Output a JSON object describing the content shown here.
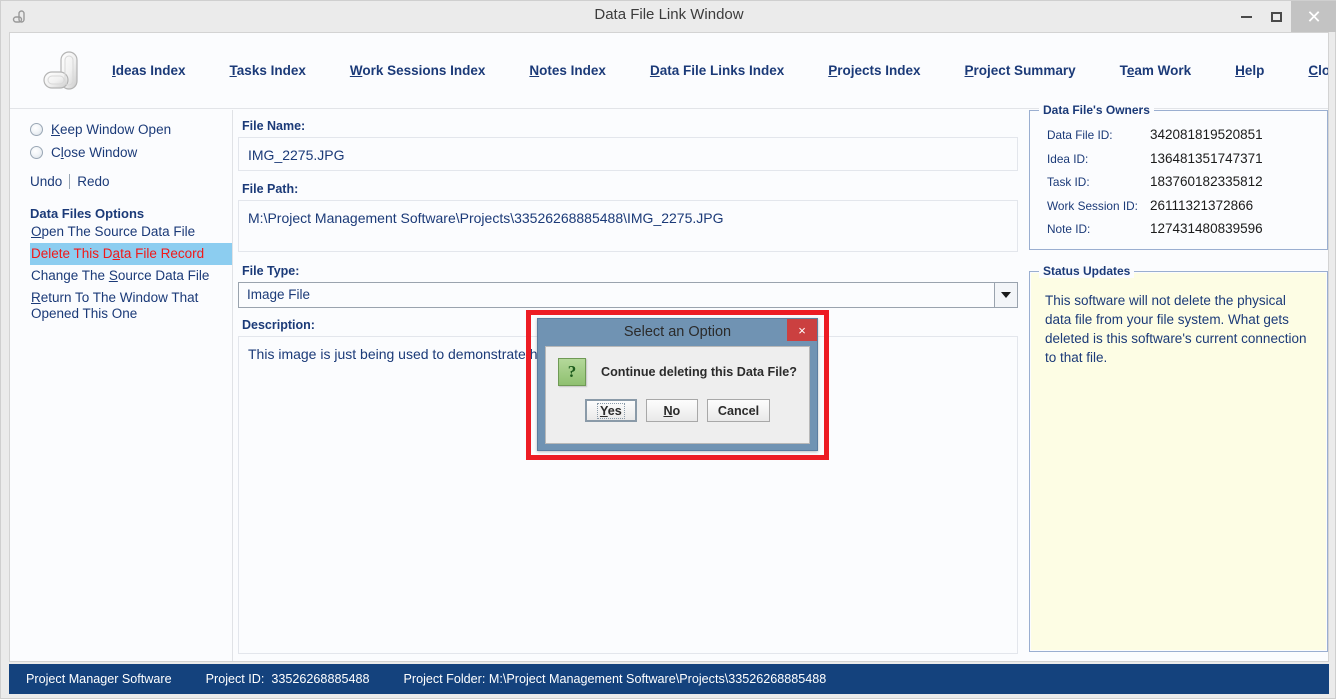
{
  "window": {
    "title": "Data File Link Window",
    "icon": "app-logo-icon",
    "controls": {
      "minimize": "–",
      "maximize": "□",
      "close": "✕"
    }
  },
  "nav": {
    "items": [
      {
        "label": "Ideas Index",
        "mnemonic": "I",
        "rest": "deas Index"
      },
      {
        "label": "Tasks Index",
        "mnemonic": "T",
        "rest": "asks Index"
      },
      {
        "label": "Work Sessions Index",
        "mnemonic": "W",
        "rest": "ork Sessions Index"
      },
      {
        "label": "Notes Index",
        "mnemonic": "N",
        "rest": "otes Index"
      },
      {
        "label": "Data File Links Index",
        "mnemonic": "D",
        "rest": "ata File Links Index"
      },
      {
        "label": "Projects Index",
        "mnemonic": "P",
        "rest": "rojects Index"
      },
      {
        "label": "Project Summary",
        "mnemonic": "P",
        "rest": "roject Summary"
      },
      {
        "label": "Team Work",
        "mnemonic": "e",
        "pre": "T",
        "rest": "am Work"
      },
      {
        "label": "Help",
        "mnemonic": "H",
        "rest": "elp"
      },
      {
        "label": "Close Program",
        "mnemonic": "C",
        "rest": "lose Program"
      }
    ]
  },
  "sidebar": {
    "radios": [
      {
        "pre": "",
        "mnemonic": "K",
        "rest": "eep Window Open",
        "label": "Keep Window Open",
        "selected": false
      },
      {
        "pre": "C",
        "mnemonic": "l",
        "rest": "ose Window",
        "label": "Close Window",
        "selected": false
      }
    ],
    "undo": "Undo",
    "redo": "Redo",
    "section_title": "Data Files Options",
    "options": [
      {
        "pre": "",
        "mnemonic": "O",
        "rest": "pen The Source Data File",
        "label": "Open The Source Data File",
        "selected": false
      },
      {
        "pre": "Delete This D",
        "mnemonic": "a",
        "rest": "ta File Record",
        "label": "Delete This Data File Record",
        "selected": true
      },
      {
        "pre": "Change The ",
        "mnemonic": "S",
        "rest": "ource Data File",
        "label": "Change The Source Data File",
        "selected": false
      },
      {
        "pre": "",
        "mnemonic": "R",
        "rest": "eturn To The Window That Opened This One",
        "label": "Return To The Window That Opened This One",
        "selected": false
      }
    ]
  },
  "form": {
    "file_name_label": "File Name:",
    "file_name_value": "IMG_2275.JPG",
    "file_path_label": "File Path:",
    "file_path_value": "M:\\Project Management Software\\Projects\\33526268885488\\IMG_2275.JPG",
    "file_type_label": "File Type:",
    "file_type_value": "Image File",
    "description_label": "Description:",
    "description_value": "This image is just being used to demonstrate how to use the Data File Link Window."
  },
  "owners": {
    "legend": "Data File's Owners",
    "rows": [
      {
        "key": "Data File ID:",
        "value": "342081819520851"
      },
      {
        "key": "Idea ID:",
        "value": "136481351747371"
      },
      {
        "key": "Task ID:",
        "value": "183760182335812"
      },
      {
        "key": "Work Session ID:",
        "value": "26111321372866"
      },
      {
        "key": "Note ID:",
        "value": "127431480839596"
      }
    ]
  },
  "status_updates": {
    "legend": "Status Updates",
    "text": "This software will not delete the physical data file from your file system. What gets deleted is this software's current connection to that file."
  },
  "statusbar": {
    "app_name": "Project Manager Software",
    "project_id_label": "Project ID:",
    "project_id_value": "33526268885488",
    "project_folder": "Project Folder: M:\\Project Management Software\\Projects\\33526268885488"
  },
  "dialog": {
    "title": "Select an Option",
    "close": "×",
    "icon": "?",
    "message": "Continue deleting this Data File?",
    "buttons": [
      {
        "label": "Yes",
        "mnemonic": "Y",
        "rest": "es",
        "default": true
      },
      {
        "label": "No",
        "mnemonic": "N",
        "rest": "o",
        "default": false
      },
      {
        "label": "Cancel",
        "mnemonic": "",
        "rest": "Cancel",
        "default": false
      }
    ]
  },
  "colors": {
    "accent_blue": "#1b3a78",
    "statusbar_blue": "#14427d",
    "selected_item_bg": "#8ccdf0",
    "selected_item_fg": "#f21818",
    "annotation_red": "#ed1c24",
    "dialog_titlebar": "#7093b3",
    "dialog_close_red": "#cb4040",
    "status_panel_bg": "#fdfde4"
  }
}
